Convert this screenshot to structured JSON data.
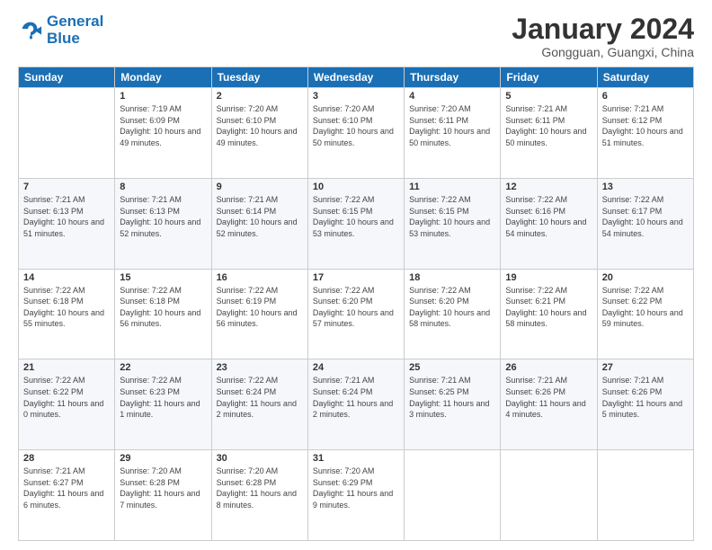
{
  "logo": {
    "line1": "General",
    "line2": "Blue"
  },
  "title": "January 2024",
  "subtitle": "Gongguan, Guangxi, China",
  "header_days": [
    "Sunday",
    "Monday",
    "Tuesday",
    "Wednesday",
    "Thursday",
    "Friday",
    "Saturday"
  ],
  "weeks": [
    [
      {
        "day": "",
        "info": ""
      },
      {
        "day": "1",
        "info": "Sunrise: 7:19 AM\nSunset: 6:09 PM\nDaylight: 10 hours\nand 49 minutes."
      },
      {
        "day": "2",
        "info": "Sunrise: 7:20 AM\nSunset: 6:10 PM\nDaylight: 10 hours\nand 49 minutes."
      },
      {
        "day": "3",
        "info": "Sunrise: 7:20 AM\nSunset: 6:10 PM\nDaylight: 10 hours\nand 50 minutes."
      },
      {
        "day": "4",
        "info": "Sunrise: 7:20 AM\nSunset: 6:11 PM\nDaylight: 10 hours\nand 50 minutes."
      },
      {
        "day": "5",
        "info": "Sunrise: 7:21 AM\nSunset: 6:11 PM\nDaylight: 10 hours\nand 50 minutes."
      },
      {
        "day": "6",
        "info": "Sunrise: 7:21 AM\nSunset: 6:12 PM\nDaylight: 10 hours\nand 51 minutes."
      }
    ],
    [
      {
        "day": "7",
        "info": "Sunrise: 7:21 AM\nSunset: 6:13 PM\nDaylight: 10 hours\nand 51 minutes."
      },
      {
        "day": "8",
        "info": "Sunrise: 7:21 AM\nSunset: 6:13 PM\nDaylight: 10 hours\nand 52 minutes."
      },
      {
        "day": "9",
        "info": "Sunrise: 7:21 AM\nSunset: 6:14 PM\nDaylight: 10 hours\nand 52 minutes."
      },
      {
        "day": "10",
        "info": "Sunrise: 7:22 AM\nSunset: 6:15 PM\nDaylight: 10 hours\nand 53 minutes."
      },
      {
        "day": "11",
        "info": "Sunrise: 7:22 AM\nSunset: 6:15 PM\nDaylight: 10 hours\nand 53 minutes."
      },
      {
        "day": "12",
        "info": "Sunrise: 7:22 AM\nSunset: 6:16 PM\nDaylight: 10 hours\nand 54 minutes."
      },
      {
        "day": "13",
        "info": "Sunrise: 7:22 AM\nSunset: 6:17 PM\nDaylight: 10 hours\nand 54 minutes."
      }
    ],
    [
      {
        "day": "14",
        "info": "Sunrise: 7:22 AM\nSunset: 6:18 PM\nDaylight: 10 hours\nand 55 minutes."
      },
      {
        "day": "15",
        "info": "Sunrise: 7:22 AM\nSunset: 6:18 PM\nDaylight: 10 hours\nand 56 minutes."
      },
      {
        "day": "16",
        "info": "Sunrise: 7:22 AM\nSunset: 6:19 PM\nDaylight: 10 hours\nand 56 minutes."
      },
      {
        "day": "17",
        "info": "Sunrise: 7:22 AM\nSunset: 6:20 PM\nDaylight: 10 hours\nand 57 minutes."
      },
      {
        "day": "18",
        "info": "Sunrise: 7:22 AM\nSunset: 6:20 PM\nDaylight: 10 hours\nand 58 minutes."
      },
      {
        "day": "19",
        "info": "Sunrise: 7:22 AM\nSunset: 6:21 PM\nDaylight: 10 hours\nand 58 minutes."
      },
      {
        "day": "20",
        "info": "Sunrise: 7:22 AM\nSunset: 6:22 PM\nDaylight: 10 hours\nand 59 minutes."
      }
    ],
    [
      {
        "day": "21",
        "info": "Sunrise: 7:22 AM\nSunset: 6:22 PM\nDaylight: 11 hours\nand 0 minutes."
      },
      {
        "day": "22",
        "info": "Sunrise: 7:22 AM\nSunset: 6:23 PM\nDaylight: 11 hours\nand 1 minute."
      },
      {
        "day": "23",
        "info": "Sunrise: 7:22 AM\nSunset: 6:24 PM\nDaylight: 11 hours\nand 2 minutes."
      },
      {
        "day": "24",
        "info": "Sunrise: 7:21 AM\nSunset: 6:24 PM\nDaylight: 11 hours\nand 2 minutes."
      },
      {
        "day": "25",
        "info": "Sunrise: 7:21 AM\nSunset: 6:25 PM\nDaylight: 11 hours\nand 3 minutes."
      },
      {
        "day": "26",
        "info": "Sunrise: 7:21 AM\nSunset: 6:26 PM\nDaylight: 11 hours\nand 4 minutes."
      },
      {
        "day": "27",
        "info": "Sunrise: 7:21 AM\nSunset: 6:26 PM\nDaylight: 11 hours\nand 5 minutes."
      }
    ],
    [
      {
        "day": "28",
        "info": "Sunrise: 7:21 AM\nSunset: 6:27 PM\nDaylight: 11 hours\nand 6 minutes."
      },
      {
        "day": "29",
        "info": "Sunrise: 7:20 AM\nSunset: 6:28 PM\nDaylight: 11 hours\nand 7 minutes."
      },
      {
        "day": "30",
        "info": "Sunrise: 7:20 AM\nSunset: 6:28 PM\nDaylight: 11 hours\nand 8 minutes."
      },
      {
        "day": "31",
        "info": "Sunrise: 7:20 AM\nSunset: 6:29 PM\nDaylight: 11 hours\nand 9 minutes."
      },
      {
        "day": "",
        "info": ""
      },
      {
        "day": "",
        "info": ""
      },
      {
        "day": "",
        "info": ""
      }
    ]
  ]
}
